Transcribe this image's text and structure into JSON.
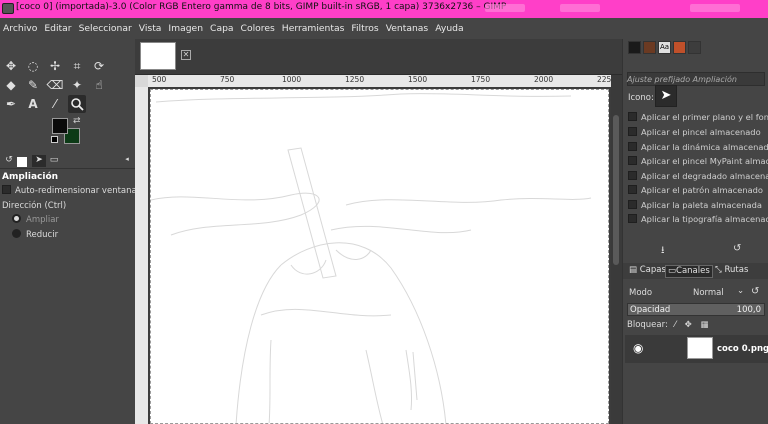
{
  "window": {
    "title": "[coco 0] (importada)-3.0 (Color RGB Entero gamma de 8 bits, GIMP built-in sRGB, 1 capa) 3736x2736 – GIMP"
  },
  "menu": [
    "Archivo",
    "Editar",
    "Seleccionar",
    "Vista",
    "Imagen",
    "Capa",
    "Colores",
    "Herramientas",
    "Filtros",
    "Ventanas",
    "Ayuda"
  ],
  "toolbox": {
    "tools": [
      {
        "name": "move-tool-icon",
        "glyph": "✥"
      },
      {
        "name": "lasso-tool-icon",
        "glyph": "◌"
      },
      {
        "name": "warp-tool-icon",
        "glyph": "✢"
      },
      {
        "name": "crop-tool-icon",
        "glyph": "⌗"
      },
      {
        "name": "transform-tool-icon",
        "glyph": "⟳"
      },
      {
        "name": "bucket-fill-icon",
        "glyph": "◆"
      },
      {
        "name": "paintbrush-icon",
        "glyph": "✎"
      },
      {
        "name": "eraser-icon",
        "glyph": "⌫"
      },
      {
        "name": "clone-icon",
        "glyph": "✦"
      },
      {
        "name": "smudge-icon",
        "glyph": "☝"
      },
      {
        "name": "paths-tool-icon",
        "glyph": "✒"
      },
      {
        "name": "text-tool-icon",
        "glyph": "A"
      },
      {
        "name": "color-picker-icon",
        "glyph": "⁄"
      },
      {
        "name": "zoom-tool-icon",
        "glyph": "⚲"
      }
    ],
    "fg_color": "#0a0a0a",
    "bg_color": "#0c3a16"
  },
  "tool_options": {
    "title": "Ampliación",
    "auto_resize": "Auto-redimensionar ventana",
    "direction_label": "Dirección  (Ctrl)",
    "zoom_in": "Ampliar",
    "zoom_out": "Reducir"
  },
  "ruler": {
    "ticks": [
      "500",
      "750",
      "1000",
      "1250",
      "1500",
      "1750",
      "2000",
      "225"
    ]
  },
  "presets": {
    "placeholder": "Ajuste prefijado Ampliación",
    "icon_label": "Icono:",
    "items": [
      "Aplicar el primer plano y el fondo",
      "Aplicar el pincel almacenado",
      "Aplicar la dinámica almacenada",
      "Aplicar el pincel MyPaint almacen",
      "Aplicar el degradado almacenado",
      "Aplicar el patrón almacenado",
      "Aplicar la paleta almacenada",
      "Aplicar la tipografía almacenada"
    ]
  },
  "layers_panel": {
    "tabs": [
      "Capas",
      "Canales",
      "Rutas"
    ],
    "mode_label": "Modo",
    "mode_value": "Normal",
    "opacity_label": "Opacidad",
    "opacity_value": "100,0",
    "lock_label": "Bloquear:",
    "layer_name": "coco 0.png"
  }
}
